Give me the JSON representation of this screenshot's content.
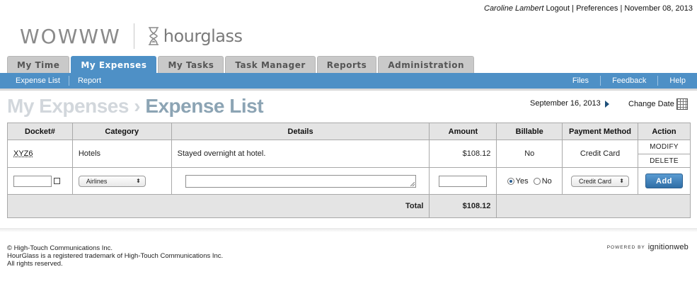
{
  "topbar": {
    "user": "Caroline Lambert",
    "logout": "Logout",
    "divider": "|",
    "preferences": "Preferences",
    "date": "November 08, 2013"
  },
  "brand": {
    "company": "WOWWW",
    "product": "hourglass"
  },
  "tabs": [
    {
      "label": "My Time",
      "active": false
    },
    {
      "label": "My Expenses",
      "active": true
    },
    {
      "label": "My Tasks",
      "active": false
    },
    {
      "label": "Task Manager",
      "active": false
    },
    {
      "label": "Reports",
      "active": false
    },
    {
      "label": "Administration",
      "active": false
    }
  ],
  "subnav": {
    "left": [
      "Expense List",
      "Report"
    ],
    "right": [
      "Files",
      "Feedback",
      "Help"
    ]
  },
  "page": {
    "crumb": "My Expenses",
    "chevron": "›",
    "title": "Expense List",
    "selected_date": "September 16, 2013",
    "change_date": "Change Date"
  },
  "table": {
    "headers": [
      "Docket#",
      "Category",
      "Details",
      "Amount",
      "Billable",
      "Payment Method",
      "Action"
    ],
    "rows": [
      {
        "docket": "XYZ6",
        "category": "Hotels",
        "details": "Stayed overnight at hotel.",
        "amount": "$108.12",
        "billable": "No",
        "payment": "Credit Card",
        "actions": [
          "MODIFY",
          "DELETE"
        ]
      }
    ],
    "new_row": {
      "docket_value": "",
      "category_selected": "Airlines",
      "details_value": "",
      "amount_value": "",
      "billable_yes": "Yes",
      "billable_no": "No",
      "billable_selected": "Yes",
      "payment_selected": "Credit Card",
      "add_label": "Add"
    },
    "total_label": "Total",
    "total_value": "$108.12"
  },
  "footer": {
    "line1": "© High-Touch Communications Inc.",
    "line2": "HourGlass is a registered trademark of High-Touch Communications Inc.",
    "line3": "All rights reserved.",
    "powered_by": "POWERED BY",
    "powered_brand": "ignitionweb"
  },
  "colors": {
    "accent": "#4e90c6",
    "tab_inactive": "#c9c9c9",
    "header_bg": "#e4e4e4",
    "title_current": "#8ca4b4",
    "title_crumb": "#d2d7dc"
  }
}
